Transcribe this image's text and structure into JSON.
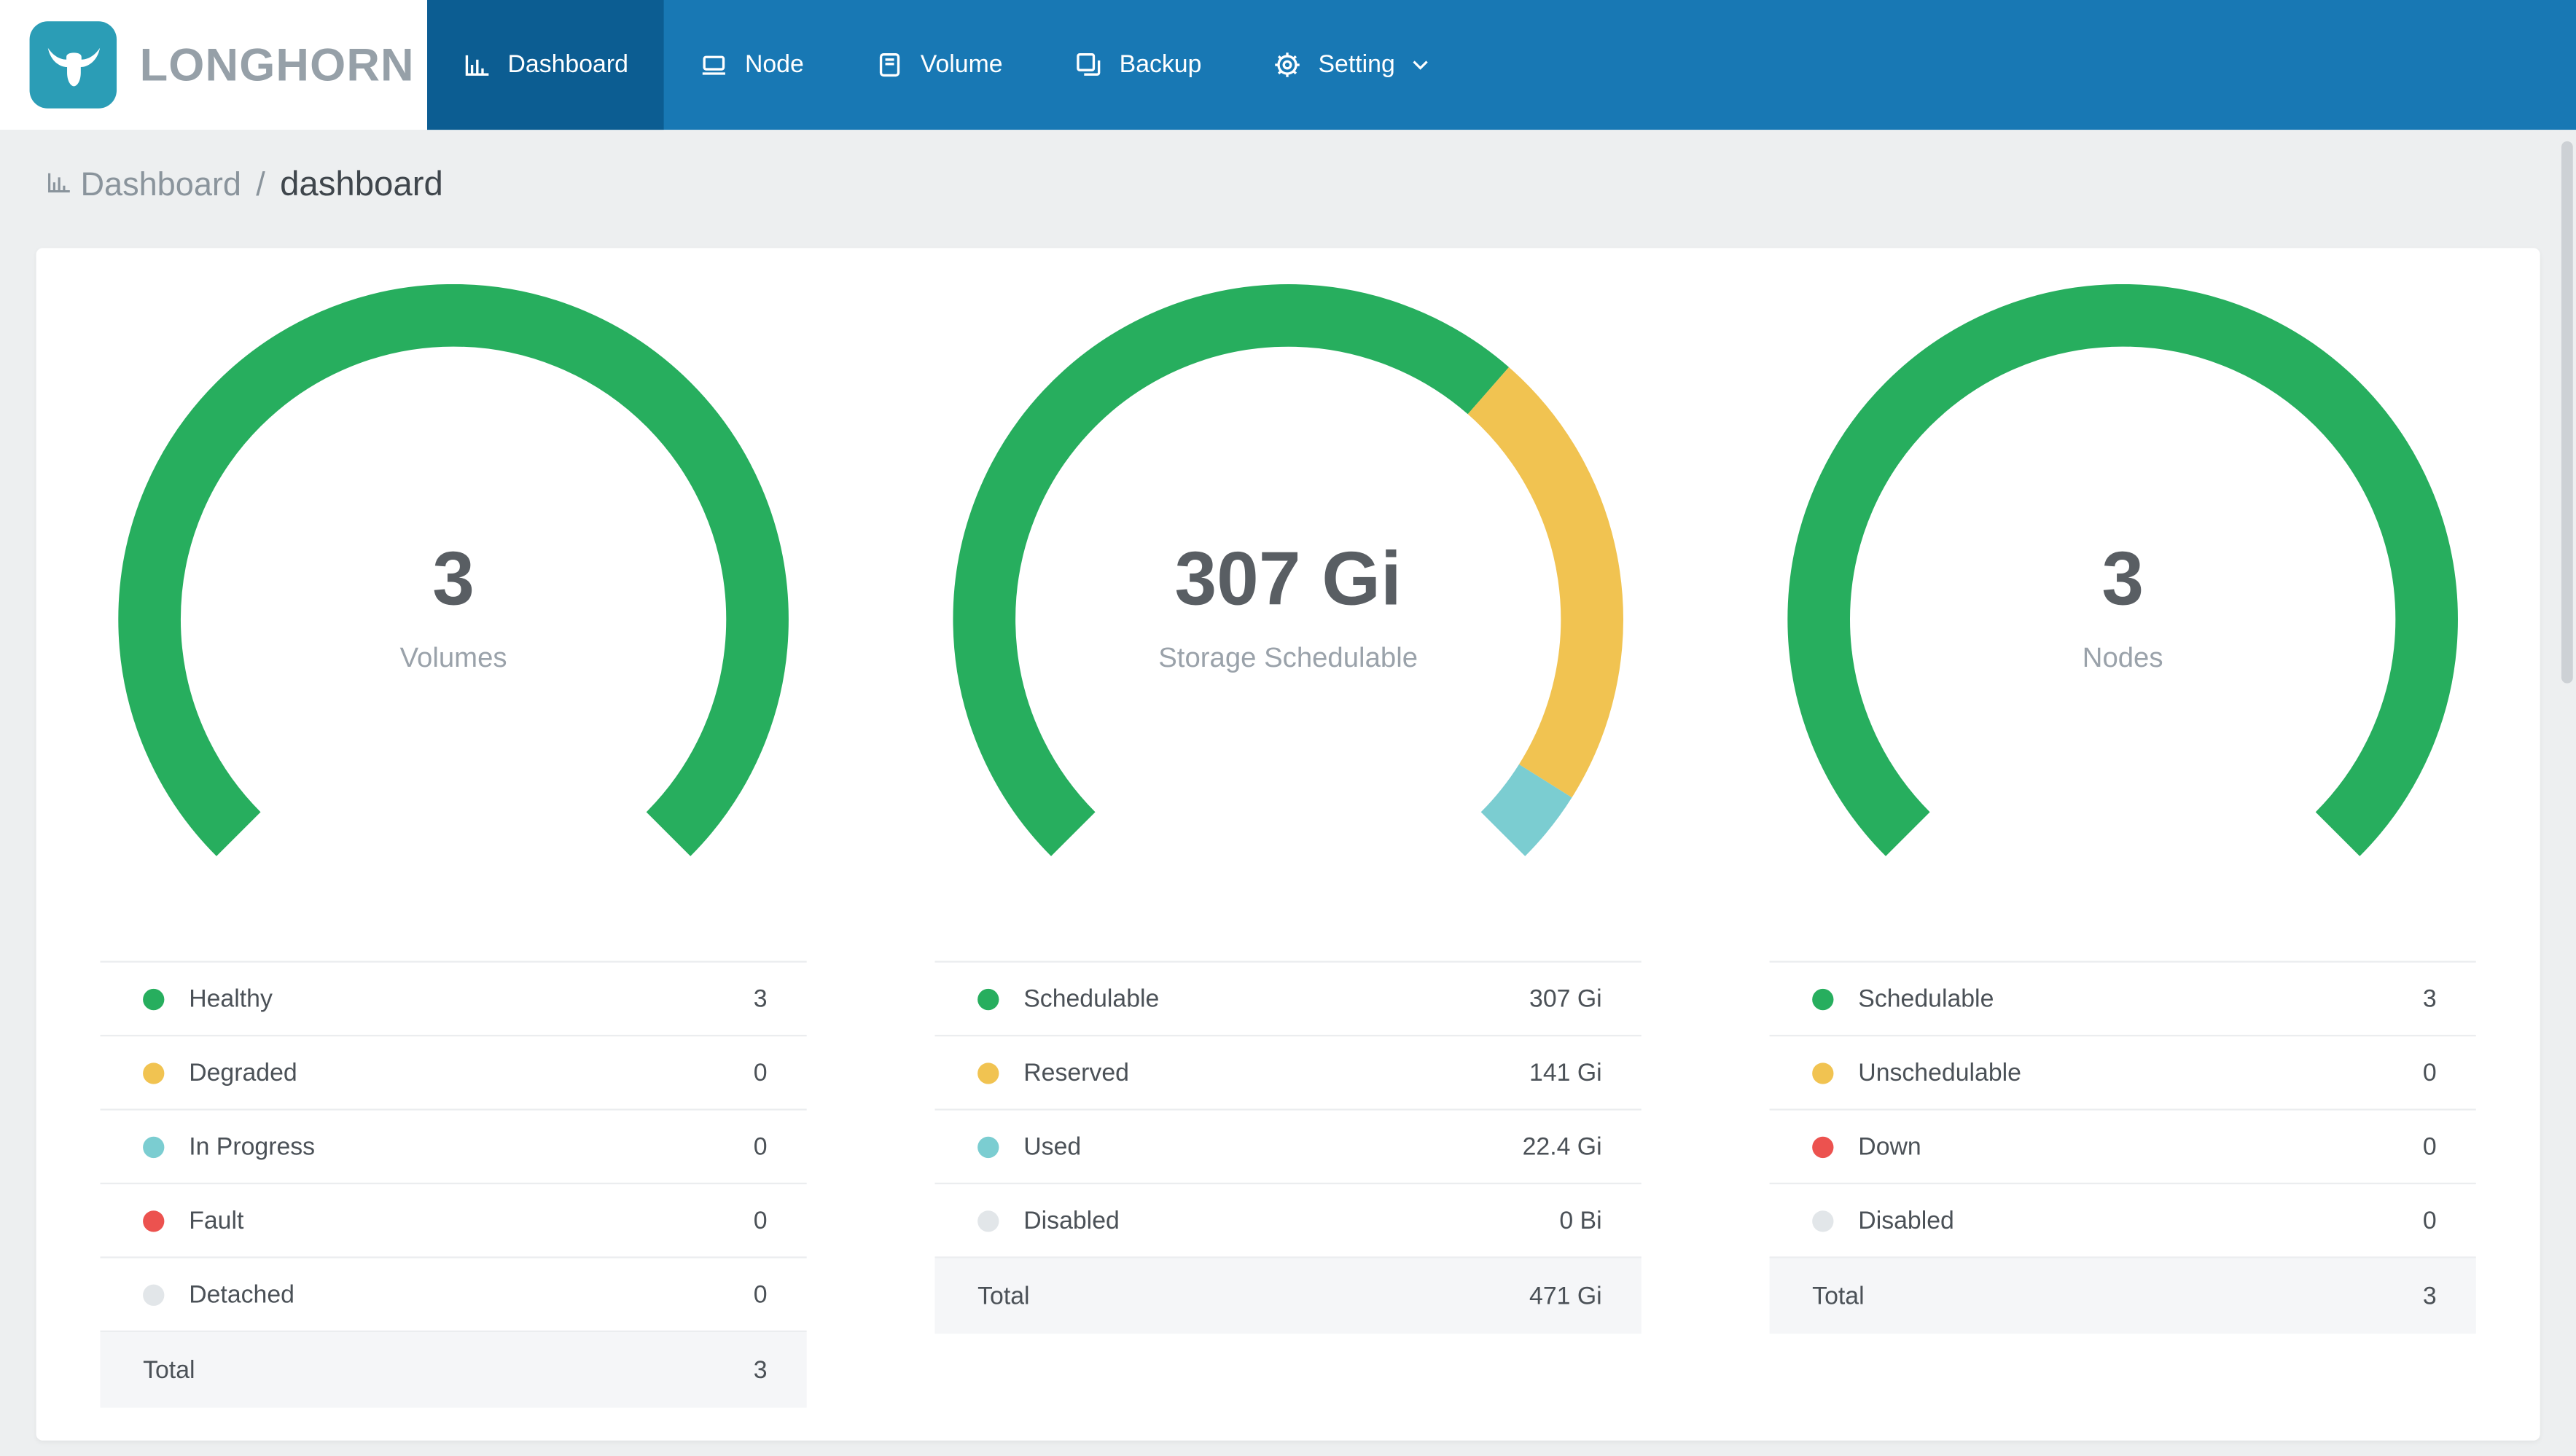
{
  "brand": {
    "name": "LONGHORN"
  },
  "nav": {
    "items": [
      {
        "label": "Dashboard",
        "active": true
      },
      {
        "label": "Node",
        "active": false
      },
      {
        "label": "Volume",
        "active": false
      },
      {
        "label": "Backup",
        "active": false
      },
      {
        "label": "Setting",
        "active": false
      }
    ]
  },
  "breadcrumb": {
    "section": "Dashboard",
    "separator": "/",
    "page": "dashboard"
  },
  "colors": {
    "green": "#27ae5e",
    "yellow": "#f1c351",
    "teal": "#7bcdd1",
    "red": "#ec524f",
    "gray": "#e2e6e9",
    "nav_bar": "#1878b4",
    "nav_active": "#0c5d92",
    "logo": "#2b9db6"
  },
  "chart_data": [
    {
      "type": "gauge",
      "name": "volumes",
      "center_value": "3",
      "center_label": "Volumes",
      "span_degrees": 270,
      "legend_position": "bottom",
      "rows": [
        {
          "label": "Healthy",
          "value": 3,
          "display": "3",
          "color": "green"
        },
        {
          "label": "Degraded",
          "value": 0,
          "display": "0",
          "color": "yellow"
        },
        {
          "label": "In Progress",
          "value": 0,
          "display": "0",
          "color": "teal"
        },
        {
          "label": "Fault",
          "value": 0,
          "display": "0",
          "color": "red"
        },
        {
          "label": "Detached",
          "value": 0,
          "display": "0",
          "color": "gray"
        }
      ],
      "total": {
        "label": "Total",
        "display": "3"
      }
    },
    {
      "type": "gauge",
      "name": "storage-schedulable",
      "center_value": "307 Gi",
      "center_label": "Storage Schedulable",
      "span_degrees": 270,
      "legend_position": "bottom",
      "rows": [
        {
          "label": "Schedulable",
          "value": 307,
          "display": "307 Gi",
          "color": "green"
        },
        {
          "label": "Reserved",
          "value": 141,
          "display": "141 Gi",
          "color": "yellow"
        },
        {
          "label": "Used",
          "value": 22.4,
          "display": "22.4 Gi",
          "color": "teal"
        },
        {
          "label": "Disabled",
          "value": 0,
          "display": "0 Bi",
          "color": "gray"
        }
      ],
      "total": {
        "label": "Total",
        "display": "471 Gi"
      }
    },
    {
      "type": "gauge",
      "name": "nodes",
      "center_value": "3",
      "center_label": "Nodes",
      "span_degrees": 270,
      "legend_position": "bottom",
      "rows": [
        {
          "label": "Schedulable",
          "value": 3,
          "display": "3",
          "color": "green"
        },
        {
          "label": "Unschedulable",
          "value": 0,
          "display": "0",
          "color": "yellow"
        },
        {
          "label": "Down",
          "value": 0,
          "display": "0",
          "color": "red"
        },
        {
          "label": "Disabled",
          "value": 0,
          "display": "0",
          "color": "gray"
        }
      ],
      "total": {
        "label": "Total",
        "display": "3"
      }
    }
  ]
}
